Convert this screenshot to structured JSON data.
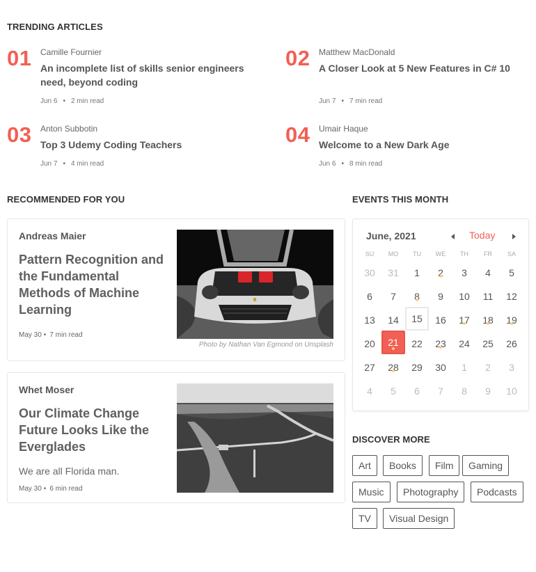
{
  "trending": {
    "title": "TRENDING ARTICLES",
    "articles": [
      {
        "num": "01",
        "author": "Camille Fournier",
        "title": "An incomplete list of skills senior engineers need, beyond coding",
        "date": "Jun 6",
        "read": "2 min read"
      },
      {
        "num": "02",
        "author": "Matthew MacDonald",
        "title": "A Closer Look at 5 New Features in C# 10",
        "date": "Jun 7",
        "read": "7 min read"
      },
      {
        "num": "03",
        "author": "Anton Subbotin",
        "title": "Top 3 Udemy Coding Teachers",
        "date": "Jun 7",
        "read": "4 min read"
      },
      {
        "num": "04",
        "author": "Umair Haque",
        "title": "Welcome to a New Dark Age",
        "date": "Jun 6",
        "read": "8 min read"
      }
    ]
  },
  "recommended": {
    "title": "RECOMMENDED FOR YOU",
    "cards": [
      {
        "author": "Andreas Maier",
        "title": "Pattern Recognition and the Fundamental Methods of Machine Learning",
        "subtitle": "",
        "date": "May 30",
        "read": "7 min read",
        "image": "white-sports-car-engine-photo",
        "caption": "Photo by Nathan Van Egmond on Unsplash"
      },
      {
        "author": "Whet Moser",
        "title": "Our Climate Change Future Looks Like the Everglades",
        "subtitle": "We are all Florida man.",
        "date": "May 30",
        "read": "6 min read",
        "image": "everglades-aerial-photo",
        "caption": ""
      }
    ]
  },
  "events": {
    "title": "EVENTS THIS MONTH",
    "month_label": "June, 2021",
    "today_label": "Today",
    "prev_icon": "triangle-left-icon",
    "next_icon": "triangle-right-icon",
    "weekdays": [
      "SU",
      "MO",
      "TU",
      "WE",
      "TH",
      "FR",
      "SA"
    ],
    "weeks": [
      [
        {
          "d": "30",
          "o": true
        },
        {
          "d": "31",
          "o": true
        },
        {
          "d": "1"
        },
        {
          "d": "2",
          "e": true
        },
        {
          "d": "3"
        },
        {
          "d": "4"
        },
        {
          "d": "5"
        }
      ],
      [
        {
          "d": "6"
        },
        {
          "d": "7"
        },
        {
          "d": "8",
          "e": true
        },
        {
          "d": "9"
        },
        {
          "d": "10"
        },
        {
          "d": "11"
        },
        {
          "d": "12"
        }
      ],
      [
        {
          "d": "13"
        },
        {
          "d": "14"
        },
        {
          "d": "15",
          "t": true
        },
        {
          "d": "16"
        },
        {
          "d": "17",
          "e": true
        },
        {
          "d": "18",
          "e": true
        },
        {
          "d": "19",
          "e": true
        }
      ],
      [
        {
          "d": "20"
        },
        {
          "d": "21",
          "s": true,
          "e": true
        },
        {
          "d": "22"
        },
        {
          "d": "23",
          "e": true
        },
        {
          "d": "24"
        },
        {
          "d": "25"
        },
        {
          "d": "26"
        }
      ],
      [
        {
          "d": "27"
        },
        {
          "d": "28",
          "e": true
        },
        {
          "d": "29"
        },
        {
          "d": "30"
        },
        {
          "d": "1",
          "o": true
        },
        {
          "d": "2",
          "o": true
        },
        {
          "d": "3",
          "o": true
        }
      ],
      [
        {
          "d": "4",
          "o": true
        },
        {
          "d": "5",
          "o": true
        },
        {
          "d": "6",
          "o": true
        },
        {
          "d": "7",
          "o": true
        },
        {
          "d": "8",
          "o": true
        },
        {
          "d": "9",
          "o": true
        },
        {
          "d": "10",
          "o": true
        }
      ]
    ],
    "accent_color": "#f25f55",
    "event_dot_color": "#ffd36b"
  },
  "discover": {
    "title": "DISCOVER MORE",
    "tags": [
      "Art",
      "Books",
      "Film",
      "Gaming",
      "Music",
      "Photography",
      "Podcasts",
      "TV",
      "Visual Design"
    ]
  }
}
